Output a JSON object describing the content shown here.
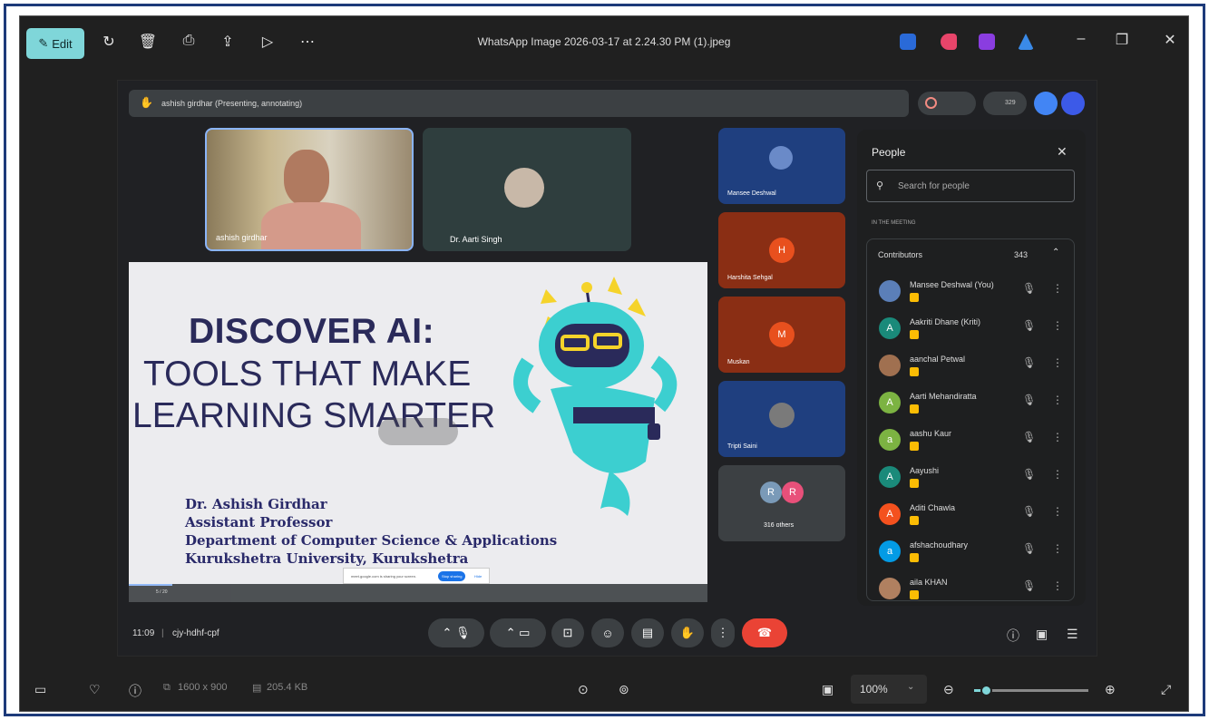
{
  "window": {
    "title": "WhatsApp Image 2026-03-17 at 2.24.30 PM (1).jpeg",
    "edit_label": "Edit"
  },
  "meet": {
    "presenting_label": "ashish girdhar (Presenting, annotating)",
    "participant_count": "329",
    "meeting_time": "11:09",
    "meeting_code": "cjy-hdhf-cpf",
    "tiles": [
      {
        "name": "ashish girdhar"
      },
      {
        "name": "Dr. Aarti Singh"
      }
    ],
    "side_tiles": [
      {
        "name": "Mansee Deshwal",
        "initial": ""
      },
      {
        "name": "Harshita Sehgal",
        "initial": "H"
      },
      {
        "name": "Muskan",
        "initial": "M"
      },
      {
        "name": "Tripti Saini",
        "initial": ""
      },
      {
        "name": "316 others",
        "initial_a": "R",
        "initial_b": "R"
      }
    ],
    "slide": {
      "title_line1": "DISCOVER AI:",
      "title_line2": "TOOLS THAT MAKE",
      "title_line3": "LEARNING SMARTER",
      "author": "Dr. Ashish Girdhar",
      "role": "Assistant Professor",
      "dept": "Department of Computer Science & Applications",
      "univ": "Kurukshetra University, Kurukshetra",
      "page_indicator": "5 / 20",
      "banner_text": "meet.google.com is sharing your screen.",
      "stop_label": "Stop sharing",
      "hide_label": "Hide"
    }
  },
  "people": {
    "title": "People",
    "search_placeholder": "Search for people",
    "section_label": "IN THE MEETING",
    "group_label": "Contributors",
    "group_count": "343",
    "list": [
      {
        "name": "Mansee Deshwal (You)",
        "initial": "",
        "color": "#5b7fb8"
      },
      {
        "name": "Aakriti Dhane (Kriti)",
        "initial": "A",
        "color": "#1a8a7a"
      },
      {
        "name": "aanchal Petwal",
        "initial": "",
        "color": "#a07050"
      },
      {
        "name": "Aarti Mehandiratta",
        "initial": "A",
        "color": "#7cb342"
      },
      {
        "name": "aashu Kaur",
        "initial": "a",
        "color": "#7cb342"
      },
      {
        "name": "Aayushi",
        "initial": "A",
        "color": "#1a8a7a"
      },
      {
        "name": "Aditi Chawla",
        "initial": "A",
        "color": "#f4511e"
      },
      {
        "name": "afshachoudhary",
        "initial": "a",
        "color": "#039be5"
      },
      {
        "name": "aila KHAN",
        "initial": "",
        "color": "#b08060"
      }
    ]
  },
  "bottombar": {
    "dimensions": "1600 x 900",
    "filesize": "205.4 KB",
    "zoom": "100%",
    "zoom_fraction": 0.1
  },
  "colors": {
    "accent": "#7fd6d9",
    "end_call": "#ea4335",
    "slide_text": "#2a2a5a",
    "robot": "#3ccfd0"
  }
}
